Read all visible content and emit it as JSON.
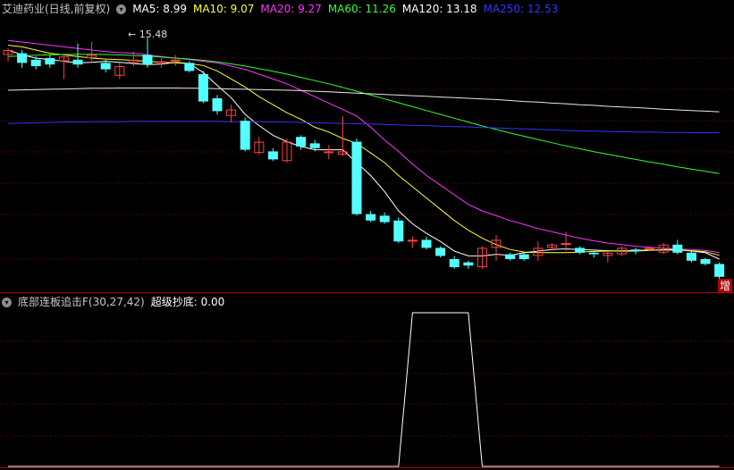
{
  "header": {
    "stock_title": "艾迪药业(日线,前复权)",
    "ma_items": [
      {
        "label": "MA5: 8.99",
        "color": "#ffffff"
      },
      {
        "label": "MA10: 9.07",
        "color": "#ffff33"
      },
      {
        "label": "MA20: 9.27",
        "color": "#ff33ff"
      },
      {
        "label": "MA60: 11.26",
        "color": "#33ff33"
      },
      {
        "label": "MA120: 13.18",
        "color": "#ffffff"
      },
      {
        "label": "MA250: 12.53",
        "color": "#3333ff"
      }
    ]
  },
  "indicator_header": {
    "name": "底部连板追击F(30,27,42)",
    "value_label": "超级抄底: 0.00"
  },
  "peak_label": "15.48",
  "zeng_label": "增",
  "colors": {
    "up": "#ff4040",
    "down": "#54ffff",
    "grid": "#7a0000",
    "separator": "#b00000"
  },
  "chart_data": {
    "type": "candlestick",
    "candles": [
      [
        14.95,
        15.1,
        14.75,
        15.15
      ],
      [
        15.0,
        14.7,
        14.55,
        15.1
      ],
      [
        14.8,
        14.6,
        14.5,
        14.9
      ],
      [
        14.85,
        14.65,
        14.55,
        14.95
      ],
      [
        14.75,
        14.9,
        14.2,
        15.0
      ],
      [
        14.8,
        14.65,
        14.55,
        15.3
      ],
      [
        14.85,
        14.95,
        14.75,
        15.35
      ],
      [
        14.7,
        14.5,
        14.4,
        14.8
      ],
      [
        14.3,
        14.6,
        14.2,
        14.7
      ],
      [
        14.7,
        14.8,
        14.6,
        15.05
      ],
      [
        14.95,
        14.65,
        14.55,
        15.48
      ],
      [
        14.7,
        14.75,
        14.55,
        14.85
      ],
      [
        14.75,
        14.8,
        14.6,
        14.95
      ],
      [
        14.7,
        14.45,
        14.4,
        14.75
      ],
      [
        14.35,
        13.5,
        13.45,
        14.45
      ],
      [
        13.6,
        13.2,
        13.1,
        13.7
      ],
      [
        13.05,
        13.25,
        12.85,
        13.4
      ],
      [
        12.9,
        12.0,
        11.95,
        13.0
      ],
      [
        11.9,
        12.25,
        11.85,
        12.4
      ],
      [
        11.95,
        11.7,
        11.65,
        12.05
      ],
      [
        11.65,
        12.25,
        11.6,
        12.35
      ],
      [
        12.4,
        12.1,
        12.0,
        12.45
      ],
      [
        12.2,
        12.05,
        11.95,
        12.3
      ],
      [
        11.9,
        11.95,
        11.7,
        12.15
      ],
      [
        11.85,
        11.95,
        11.8,
        13.05
      ],
      [
        12.25,
        10.0,
        9.95,
        12.35
      ],
      [
        10.0,
        9.8,
        9.75,
        10.1
      ],
      [
        9.95,
        9.75,
        9.7,
        10.05
      ],
      [
        9.8,
        9.15,
        9.1,
        9.9
      ],
      [
        9.15,
        9.2,
        8.95,
        9.3
      ],
      [
        9.2,
        8.95,
        8.9,
        9.3
      ],
      [
        8.95,
        8.7,
        8.65,
        9.0
      ],
      [
        8.6,
        8.35,
        8.3,
        8.7
      ],
      [
        8.5,
        8.4,
        8.3,
        8.55
      ],
      [
        8.35,
        8.95,
        8.3,
        9.0
      ],
      [
        8.95,
        9.2,
        8.55,
        9.35
      ],
      [
        8.75,
        8.6,
        8.55,
        8.8
      ],
      [
        8.75,
        8.6,
        8.55,
        8.8
      ],
      [
        8.7,
        8.95,
        8.55,
        9.15
      ],
      [
        8.95,
        9.05,
        8.9,
        9.1
      ],
      [
        9.05,
        9.1,
        8.85,
        9.45
      ],
      [
        8.95,
        8.8,
        8.75,
        9.0
      ],
      [
        8.8,
        8.75,
        8.65,
        8.85
      ],
      [
        8.7,
        8.8,
        8.5,
        8.85
      ],
      [
        8.75,
        8.95,
        8.7,
        9.0
      ],
      [
        8.9,
        8.85,
        8.75,
        8.95
      ],
      [
        8.9,
        8.95,
        8.85,
        9.0
      ],
      [
        8.8,
        9.05,
        8.75,
        9.1
      ],
      [
        9.05,
        8.8,
        8.75,
        9.2
      ],
      [
        8.8,
        8.55,
        8.5,
        8.85
      ],
      [
        8.6,
        8.45,
        8.4,
        8.65
      ],
      [
        8.45,
        8.05,
        7.95,
        8.5
      ]
    ],
    "ma_series": [
      {
        "name": "MA5",
        "color": "#ffffff",
        "values": [
          15.1,
          14.95,
          14.85,
          14.8,
          14.75,
          14.7,
          14.72,
          14.75,
          14.72,
          14.68,
          14.65,
          14.66,
          14.72,
          14.68,
          14.4,
          14.0,
          13.62,
          13.1,
          12.75,
          12.45,
          12.25,
          12.1,
          12.0,
          12.0,
          12.0,
          11.6,
          11.2,
          10.7,
          10.1,
          9.7,
          9.4,
          9.15,
          8.85,
          8.7,
          8.7,
          8.75,
          8.72,
          8.8,
          8.85,
          8.9,
          8.92,
          8.9,
          8.88,
          8.86,
          8.85,
          8.85,
          8.87,
          8.9,
          8.9,
          8.85,
          8.8,
          8.6
        ]
      },
      {
        "name": "MA10",
        "color": "#ffff33",
        "values": [
          15.25,
          15.2,
          15.1,
          15.0,
          14.95,
          14.9,
          14.85,
          14.82,
          14.8,
          14.78,
          14.75,
          14.72,
          14.7,
          14.68,
          14.62,
          14.45,
          14.2,
          13.95,
          13.65,
          13.4,
          13.15,
          12.95,
          12.7,
          12.55,
          12.35,
          12.2,
          11.9,
          11.6,
          11.2,
          10.85,
          10.5,
          10.15,
          9.8,
          9.5,
          9.25,
          9.05,
          8.9,
          8.82,
          8.8,
          8.8,
          8.8,
          8.82,
          8.84,
          8.85,
          8.86,
          8.87,
          8.88,
          8.88,
          8.88,
          8.86,
          8.83,
          8.72
        ]
      },
      {
        "name": "MA20",
        "color": "#ff33ff",
        "values": [
          15.4,
          15.35,
          15.3,
          15.25,
          15.2,
          15.15,
          15.1,
          15.05,
          15.02,
          15.0,
          14.95,
          14.9,
          14.85,
          14.8,
          14.75,
          14.7,
          14.6,
          14.5,
          14.35,
          14.2,
          14.05,
          13.85,
          13.65,
          13.45,
          13.25,
          13.05,
          12.7,
          12.3,
          11.95,
          11.55,
          11.2,
          10.9,
          10.6,
          10.3,
          10.1,
          9.95,
          9.8,
          9.68,
          9.55,
          9.45,
          9.35,
          9.25,
          9.17,
          9.1,
          9.05,
          9.0,
          8.97,
          8.94,
          8.92,
          8.9,
          8.87,
          8.8
        ]
      },
      {
        "name": "MA60",
        "color": "#33ff33",
        "values": [
          14.9,
          14.92,
          14.94,
          14.95,
          14.96,
          14.97,
          14.97,
          14.96,
          14.95,
          14.93,
          14.91,
          14.88,
          14.85,
          14.82,
          14.78,
          14.73,
          14.67,
          14.6,
          14.52,
          14.44,
          14.35,
          14.25,
          14.15,
          14.05,
          13.94,
          13.82,
          13.7,
          13.58,
          13.46,
          13.34,
          13.22,
          13.1,
          12.98,
          12.86,
          12.74,
          12.63,
          12.52,
          12.42,
          12.32,
          12.22,
          12.12,
          12.03,
          11.94,
          11.86,
          11.78,
          11.7,
          11.62,
          11.55,
          11.47,
          11.4,
          11.33,
          11.26
        ]
      },
      {
        "name": "MA120",
        "color": "#e8e8e8",
        "values": [
          13.85,
          13.86,
          13.87,
          13.88,
          13.89,
          13.9,
          13.91,
          13.91,
          13.92,
          13.92,
          13.92,
          13.92,
          13.92,
          13.91,
          13.91,
          13.9,
          13.89,
          13.88,
          13.87,
          13.86,
          13.85,
          13.84,
          13.82,
          13.8,
          13.78,
          13.76,
          13.74,
          13.72,
          13.7,
          13.68,
          13.66,
          13.64,
          13.62,
          13.6,
          13.58,
          13.56,
          13.53,
          13.5,
          13.48,
          13.45,
          13.43,
          13.4,
          13.38,
          13.35,
          13.33,
          13.31,
          13.29,
          13.26,
          13.24,
          13.22,
          13.2,
          13.18
        ]
      },
      {
        "name": "MA250",
        "color": "#3333ff",
        "values": [
          12.82,
          12.83,
          12.84,
          12.85,
          12.86,
          12.86,
          12.87,
          12.87,
          12.87,
          12.88,
          12.88,
          12.88,
          12.88,
          12.88,
          12.88,
          12.88,
          12.87,
          12.87,
          12.87,
          12.86,
          12.86,
          12.85,
          12.84,
          12.83,
          12.82,
          12.81,
          12.8,
          12.79,
          12.77,
          12.76,
          12.75,
          12.73,
          12.72,
          12.71,
          12.69,
          12.68,
          12.66,
          12.65,
          12.63,
          12.62,
          12.6,
          12.59,
          12.58,
          12.57,
          12.56,
          12.55,
          12.55,
          12.54,
          12.54,
          12.53,
          12.53,
          12.53
        ]
      }
    ],
    "indicator": {
      "name": "超级抄底",
      "values": [
        0,
        0,
        0,
        0,
        0,
        0,
        0,
        0,
        0,
        0,
        0,
        0,
        0,
        0,
        0,
        0,
        0,
        0,
        0,
        0,
        0,
        0,
        0,
        0,
        0,
        0,
        0,
        0,
        0,
        1,
        1,
        1,
        1,
        1,
        0,
        0,
        0,
        0,
        0,
        0,
        0,
        0,
        0,
        0,
        0,
        0,
        0,
        0,
        0,
        0,
        0,
        0
      ],
      "ylim": [
        0,
        1
      ]
    },
    "price_ylim": [
      7.6,
      16.1
    ]
  }
}
